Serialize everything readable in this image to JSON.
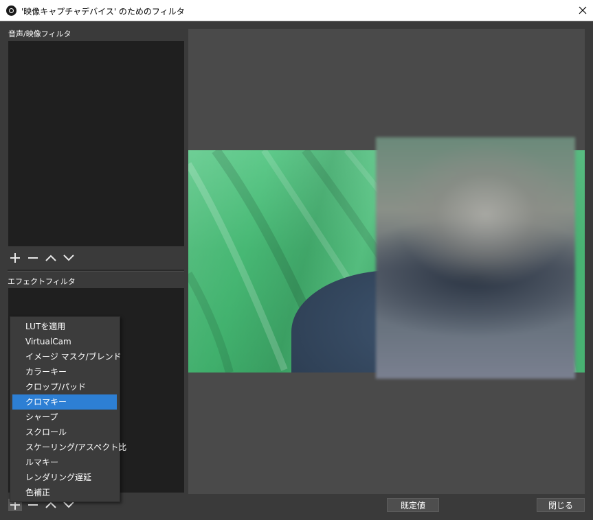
{
  "window": {
    "title": "'映像キャプチャデバイス' のためのフィルタ"
  },
  "audio_video_filters": {
    "label": "音声/映像フィルタ"
  },
  "effect_filters": {
    "label": "エフェクトフィルタ"
  },
  "context_menu": {
    "items": [
      {
        "label": "LUTを適用"
      },
      {
        "label": "VirtualCam"
      },
      {
        "label": "イメージ マスク/ブレンド"
      },
      {
        "label": "カラーキー"
      },
      {
        "label": "クロップ/パッド"
      },
      {
        "label": "クロマキー",
        "selected": true
      },
      {
        "label": "シャープ"
      },
      {
        "label": "スクロール"
      },
      {
        "label": "スケーリング/アスペクト比"
      },
      {
        "label": "ルマキー"
      },
      {
        "label": "レンダリング遅延"
      },
      {
        "label": "色補正"
      }
    ]
  },
  "buttons": {
    "defaults": "既定値",
    "close": "閉じる"
  },
  "colors": {
    "accent": "#2d7fd4",
    "background": "#3a3a3a",
    "list_background": "#1f1f1f",
    "preview_background": "#4a4a4a"
  }
}
